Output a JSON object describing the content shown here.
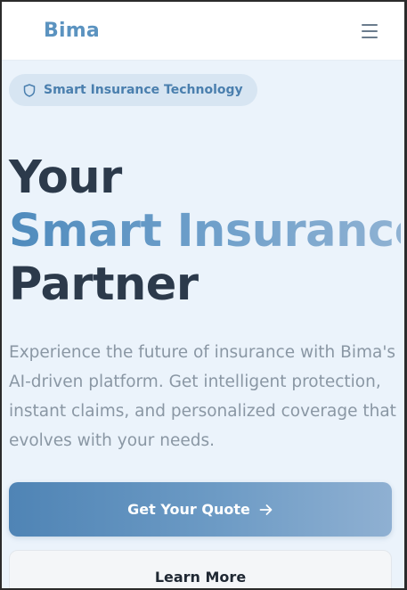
{
  "navbar": {
    "logo": "Bima",
    "menu_icon": "hamburger-menu-icon"
  },
  "badge": {
    "icon": "shield-icon",
    "label": "Smart Insurance Technology"
  },
  "hero": {
    "title_line1": "Your",
    "title_line2": "Smart Insurance",
    "title_line3": "Partner",
    "description": "Experience the future of insurance with Bima's AI-driven platform. Get intelligent protection, instant claims, and personalized coverage that evolves with your needs."
  },
  "actions": {
    "primary_label": "Get Your Quote",
    "primary_icon": "arrow-right-icon",
    "secondary_label": "Learn More"
  },
  "colors": {
    "brand": "#5b93c0",
    "gradient_start": "#4f84b5",
    "gradient_end": "#8fb0d2",
    "heading": "#2c3a4b",
    "body_text": "#8a97a4",
    "page_bg": "#ebf3fb"
  }
}
